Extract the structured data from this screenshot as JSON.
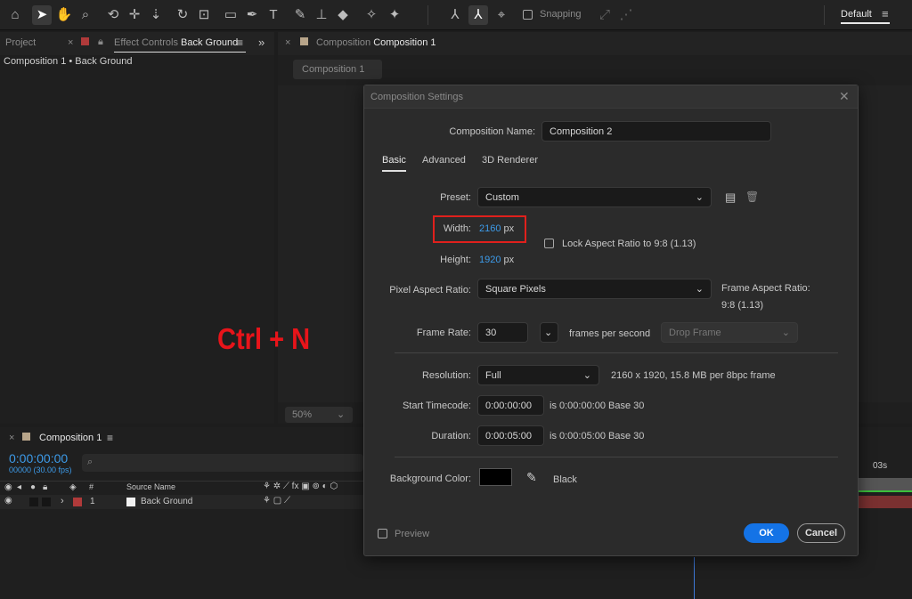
{
  "toolbar": {
    "snapping_label": "Snapping",
    "workspace_label": "Default",
    "icons": [
      "home-icon",
      "selection-tool-icon",
      "hand-tool-icon",
      "zoom-tool-icon",
      "orbit-camera-icon",
      "pan-camera-icon",
      "dolly-camera-icon",
      "rotate-tool-icon",
      "pan-behind-icon",
      "rectangle-tool-icon",
      "pen-tool-icon",
      "type-tool-icon",
      "brush-tool-icon",
      "clone-stamp-icon",
      "eraser-tool-icon",
      "roto-brush-icon",
      "puppet-pin-icon"
    ]
  },
  "project_panel": {
    "project_tab": "Project",
    "effect_controls_prefix": "Effect Controls",
    "effect_controls_layer": "Back Ground",
    "breadcrumb": "Composition 1 • Back Ground"
  },
  "composition_panel": {
    "tab_prefix": "Composition",
    "tab_name": "Composition 1",
    "sub_tab": "Composition 1",
    "zoom": "50%"
  },
  "overlay_text": "Ctrl + N",
  "timeline": {
    "tab_name": "Composition 1",
    "timecode": "0:00:00:00",
    "frames": "00000 (30.00 fps)",
    "search_placeholder": "",
    "col_hash": "#",
    "col_source": "Source Name",
    "row_num": "1",
    "row_name": "Back Ground",
    "ruler_label": "03s"
  },
  "dialog": {
    "title": "Composition Settings",
    "name_label": "Composition Name:",
    "name_value": "Composition 2",
    "tabs": [
      "Basic",
      "Advanced",
      "3D Renderer"
    ],
    "preset_label": "Preset:",
    "preset_value": "Custom",
    "width_label": "Width:",
    "width_value": "2160",
    "width_unit": "px",
    "height_label": "Height:",
    "height_value": "1920",
    "height_unit": "px",
    "lock_label": "Lock Aspect Ratio to 9:8 (1.13)",
    "par_label": "Pixel Aspect Ratio:",
    "par_value": "Square Pixels",
    "far_label": "Frame Aspect Ratio:",
    "far_value": "9:8 (1.13)",
    "frame_rate_label": "Frame Rate:",
    "frame_rate_value": "30",
    "fps_label": "frames per second",
    "drop_frame_value": "Drop Frame",
    "resolution_label": "Resolution:",
    "resolution_value": "Full",
    "resolution_info": "2160 x 1920, 15.8 MB per 8bpc frame",
    "start_tc_label": "Start Timecode:",
    "start_tc_value": "0:00:00:00",
    "start_tc_info": "is 0:00:00:00  Base 30",
    "duration_label": "Duration:",
    "duration_value": "0:00:05:00",
    "duration_info": "is 0:00:05:00  Base 30",
    "bg_color_label": "Background Color:",
    "bg_color_name": "Black",
    "bg_color_hex": "#000000",
    "preview_label": "Preview",
    "ok_label": "OK",
    "cancel_label": "Cancel"
  },
  "colors": {
    "accent": "#3d9be9",
    "highlight_box": "#e0201c",
    "overlay_text": "#e8141a",
    "ok_button": "#1473e6",
    "layer_label": "#b03a3a"
  }
}
